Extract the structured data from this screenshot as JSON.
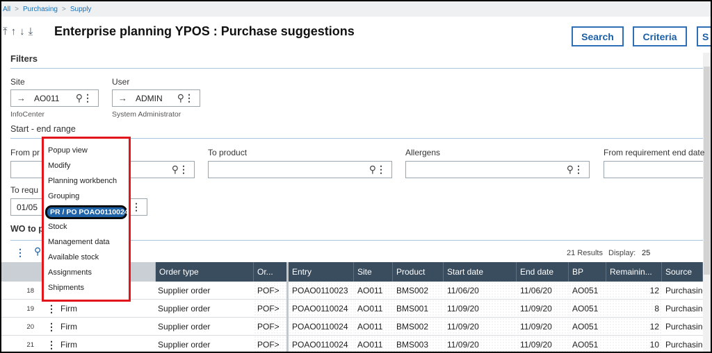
{
  "breadcrumb": {
    "items": [
      "All",
      "Purchasing",
      "Supply"
    ]
  },
  "header": {
    "title": "Enterprise planning YPOS : Purchase suggestions",
    "buttons": {
      "search": "Search",
      "criteria": "Criteria",
      "extra": "S"
    }
  },
  "filters": {
    "title": "Filters",
    "site": {
      "label": "Site",
      "value": "AO011",
      "desc": "InfoCenter"
    },
    "user": {
      "label": "User",
      "value": "ADMIN",
      "desc": "System Administrator"
    },
    "range_title": "Start - end range",
    "from_product": {
      "label": "From pr",
      "value": ""
    },
    "to_product": {
      "label": "To product",
      "value": ""
    },
    "allergens": {
      "label": "Allergens",
      "value": ""
    },
    "from_req_end": {
      "label": "From requirement end date",
      "value": ""
    },
    "to_req": {
      "label": "To requ",
      "value": "01/05"
    },
    "wo_title": "WO to p"
  },
  "results": {
    "count": "21 Results",
    "display_label": "Display:",
    "display_value": "25"
  },
  "table": {
    "columns": [
      "Order type",
      "Or...",
      "Entry",
      "Site",
      "Product",
      "Start date",
      "End date",
      "BP",
      "Remainin...",
      "Source"
    ],
    "rows": [
      {
        "n": "18",
        "status": "",
        "order_type": "Supplier order",
        "or": "POF>",
        "entry": "POAO0110023",
        "site": "AO011",
        "product": "BMS002",
        "start": "11/06/20",
        "end": "11/06/20",
        "bp": "AO051",
        "remaining": "12",
        "source": "Purchasing"
      },
      {
        "n": "19",
        "status": "Firm",
        "order_type": "Supplier order",
        "or": "POF>",
        "entry": "POAO0110024",
        "site": "AO011",
        "product": "BMS001",
        "start": "11/09/20",
        "end": "11/09/20",
        "bp": "AO051",
        "remaining": "8",
        "source": "Purchasing"
      },
      {
        "n": "20",
        "status": "Firm",
        "order_type": "Supplier order",
        "or": "POF>",
        "entry": "POAO0110024",
        "site": "AO011",
        "product": "BMS002",
        "start": "11/09/20",
        "end": "11/09/20",
        "bp": "AO051",
        "remaining": "12",
        "source": "Purchasing"
      },
      {
        "n": "21",
        "status": "Firm",
        "order_type": "Supplier order",
        "or": "POF>",
        "entry": "POAO0110024",
        "site": "AO011",
        "product": "BMS003",
        "start": "11/09/20",
        "end": "11/09/20",
        "bp": "AO051",
        "remaining": "10",
        "source": "Purchasing"
      }
    ]
  },
  "context_menu": {
    "items": [
      "Popup view",
      "Modify",
      "Planning workbench",
      "Grouping",
      "PR / PO POAO0110024",
      "Stock",
      "Management data",
      "Available stock",
      "Assignments",
      "Shipments"
    ]
  },
  "colors": {
    "accent": "#1b5fa8",
    "highlight_border": "#e3151a",
    "table_header": "#3a4d5f"
  }
}
